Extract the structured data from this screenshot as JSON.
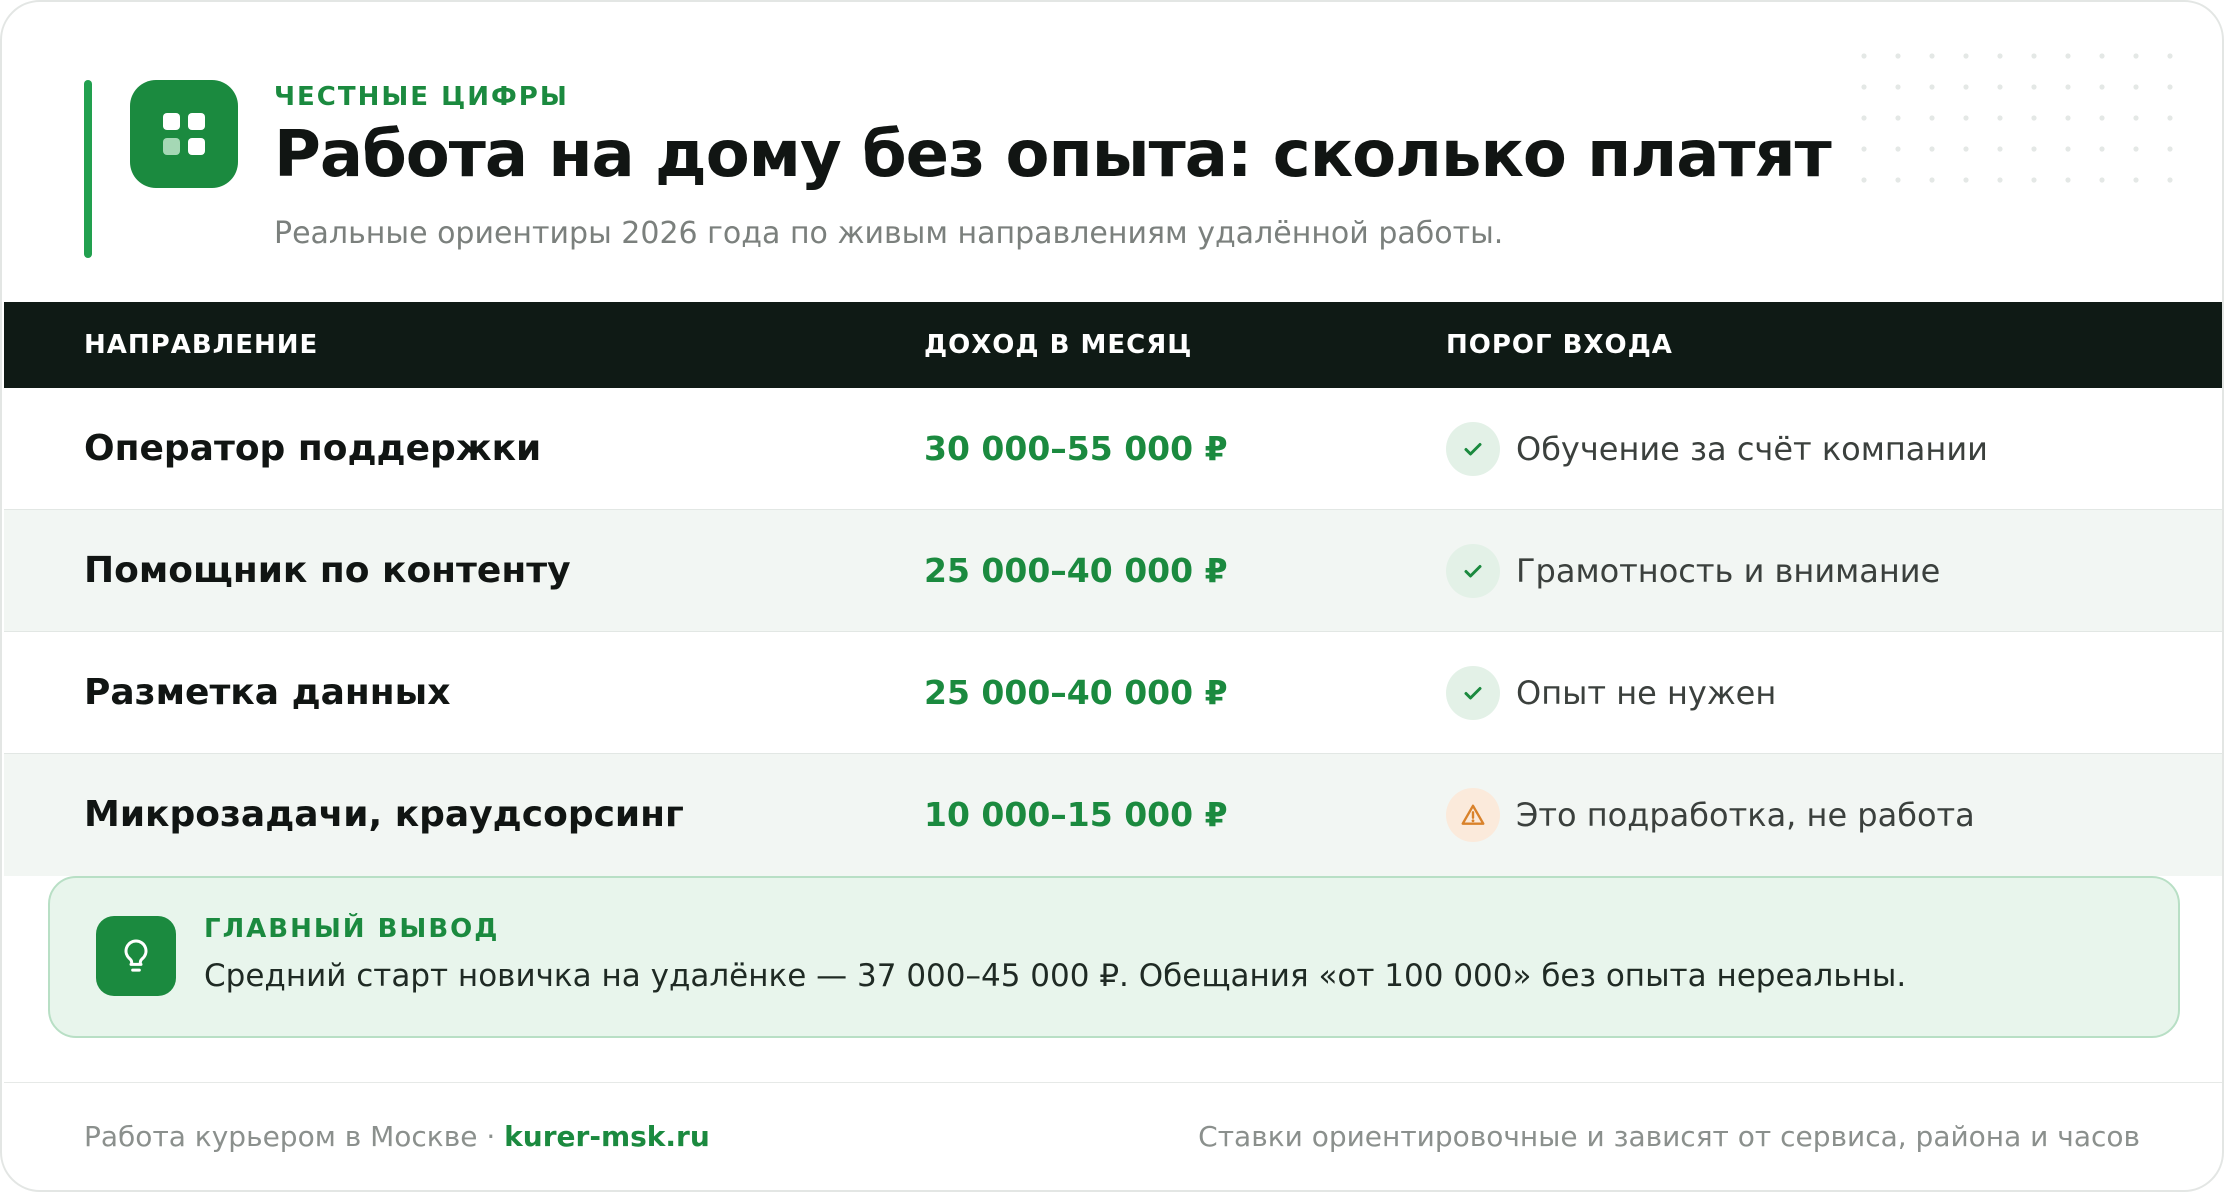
{
  "header": {
    "eyebrow": "ЧЕСТНЫЕ ЦИФРЫ",
    "title": "Работа на дому без опыта: сколько платят",
    "subtitle": "Реальные ориентиры 2026 года по живым направлениям удалённой работы.",
    "logo_icon": "grid-icon"
  },
  "table": {
    "columns": [
      "НАПРАВЛЕНИЕ",
      "ДОХОД В МЕСЯЦ",
      "ПОРОГ ВХОДА"
    ],
    "rows": [
      {
        "direction": "Оператор поддержки",
        "income": "30 000–55 000 ₽",
        "entry": "Обучение за счёт компании",
        "status": "check-icon"
      },
      {
        "direction": "Помощник по контенту",
        "income": "25 000–40 000 ₽",
        "entry": "Грамотность и внимание",
        "status": "check-icon"
      },
      {
        "direction": "Разметка данных",
        "income": "25 000–40 000 ₽",
        "entry": "Опыт не нужен",
        "status": "check-icon"
      },
      {
        "direction": "Микрозадачи, краудсорсинг",
        "income": "10 000–15 000 ₽",
        "entry": "Это подработка, не работа",
        "status": "warning-icon"
      }
    ]
  },
  "conclusion": {
    "label": "ГЛАВНЫЙ ВЫВОД",
    "text": "Средний старт новичка на удалёнке — 37 000–45 000 ₽. Обещания «от 100 000» без опыта нереальны.",
    "icon": "lightbulb-icon"
  },
  "footer": {
    "left_text": "Работа курьером в Москве · ",
    "link_text": "kurer-msk.ru",
    "right_text": "Ставки ориентировочные и зависят от сервиса, района и часов"
  },
  "colors": {
    "accent": "#1b8a3f",
    "accent_bright": "#22a04f",
    "header_bg": "#0f1a15",
    "warning": "#d9822b"
  }
}
